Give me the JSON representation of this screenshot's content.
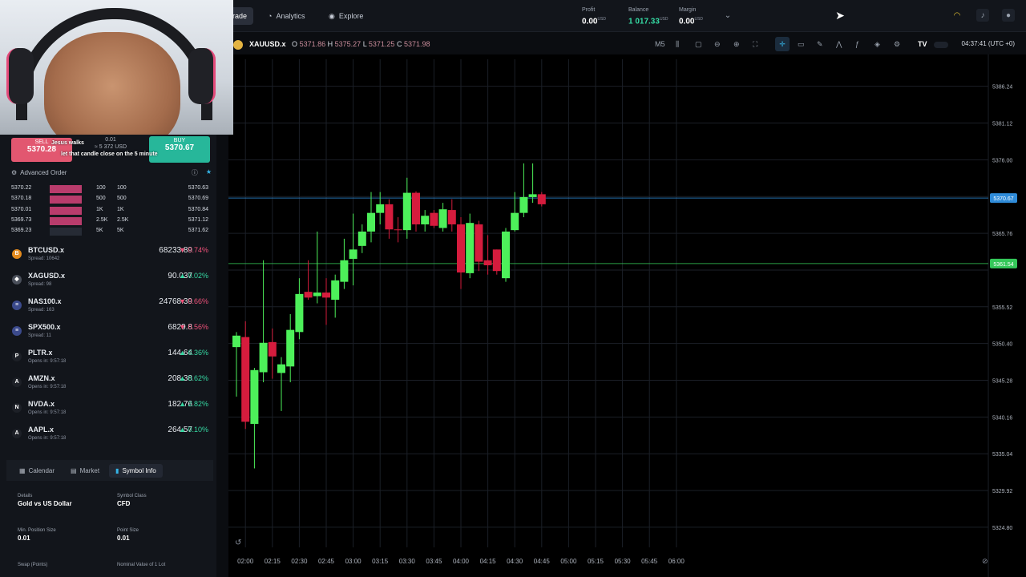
{
  "nav": {
    "trade": "rade",
    "analytics": "Analytics",
    "explore": "Explore"
  },
  "account": {
    "profit_label": "Profit",
    "profit_value": "0.00",
    "balance_label": "Balance",
    "balance_value": "1 017.33",
    "margin_label": "Margin",
    "margin_value": "0.00",
    "currency": "USD"
  },
  "stream": {
    "chat_1": "Jesus walks",
    "chat_2": "let that candle close on the 5 minute"
  },
  "order": {
    "sell_label": "SELL",
    "sell_price": "5370.28",
    "buy_label": "BUY",
    "buy_price": "5370.67",
    "quantity_lot": "0.01",
    "quantity_usd": "≈ 5 372 USD",
    "advanced_label": "Advanced Order"
  },
  "orderbook": [
    {
      "bid": "5370.22",
      "size": "100",
      "size2": "100",
      "ask": "5370.63"
    },
    {
      "bid": "5370.18",
      "size": "500",
      "size2": "500",
      "ask": "5370.69"
    },
    {
      "bid": "5370.01",
      "size": "1K",
      "size2": "1K",
      "ask": "5370.84"
    },
    {
      "bid": "5369.73",
      "size": "2.5K",
      "size2": "2.5K",
      "ask": "5371.12"
    },
    {
      "bid": "5369.23",
      "size": "5K",
      "size2": "5K",
      "ask": "5371.62"
    }
  ],
  "watchlist": [
    {
      "symbol": "BTCUSD.x",
      "sub": "Spread: 10642",
      "price": "68233.89",
      "change": "0.74%",
      "dir": "down",
      "icon": "B",
      "color": "#e38a1d"
    },
    {
      "symbol": "XAGUSD.x",
      "sub": "Spread: 98",
      "price": "90.037",
      "change": "0.02%",
      "dir": "up",
      "icon": "◆",
      "color": "#4a4f5a"
    },
    {
      "symbol": "NAS100.x",
      "sub": "Spread: 163",
      "price": "24768.39",
      "change": "0.66%",
      "dir": "down",
      "icon": "≡",
      "color": "#3b4a8c"
    },
    {
      "symbol": "SPX500.x",
      "sub": "Spread: 11",
      "price": "6829.8",
      "change": "0.56%",
      "dir": "down",
      "icon": "≡",
      "color": "#3b4a8c"
    },
    {
      "symbol": "PLTR.x",
      "sub": "Opens in: 9:57:18",
      "price": "144.64",
      "change": "6.36%",
      "dir": "up",
      "icon": "P",
      "color": "#1d2027"
    },
    {
      "symbol": "AMZN.x",
      "sub": "Opens in: 9:57:18",
      "price": "208.38",
      "change": "0.62%",
      "dir": "up",
      "icon": "A",
      "color": "#1d2027"
    },
    {
      "symbol": "NVDA.x",
      "sub": "Opens in: 9:57:18",
      "price": "182.76",
      "change": "2.82%",
      "dir": "up",
      "icon": "N",
      "color": "#1d2027"
    },
    {
      "symbol": "AAPL.x",
      "sub": "Opens in: 9:57:18",
      "price": "264.57",
      "change": "0.10%",
      "dir": "up",
      "icon": "A",
      "color": "#1d2027"
    }
  ],
  "bottom_tabs": {
    "calendar": "Calendar",
    "market": "Market",
    "symbol_info": "Symbol Info"
  },
  "symbol_info": {
    "details_label": "Details",
    "details_value": "Gold vs US Dollar",
    "class_label": "Symbol Class",
    "class_value": "CFD",
    "min_size_label": "Min. Position Size",
    "min_size_value": "0.01",
    "point_size_label": "Point Size",
    "point_size_value": "0.01",
    "swap_label": "Swap (Points)",
    "nominal_label": "Nominal Value of 1 Lot"
  },
  "chart_header": {
    "symbol": "XAUUSD.x",
    "o_label": "O",
    "o": "5371.86",
    "h_label": "H",
    "h": "5375.27",
    "l_label": "L",
    "l": "5371.25",
    "c_label": "C",
    "c": "5371.98",
    "timeframe": "M5",
    "clock": "04:37:41 (UTC +0)"
  },
  "chart_data": {
    "type": "candlestick",
    "symbol": "XAUUSD.x",
    "timeframe": "M5",
    "ylim": [
      5322,
      5390
    ],
    "y_ticks": [
      5386.24,
      5381.12,
      5376.0,
      5370.88,
      5365.76,
      5360.64,
      5355.52,
      5350.4,
      5345.28,
      5340.16,
      5335.04,
      5329.92,
      5324.8
    ],
    "y_tick_labels": [
      "5386.24",
      "5381.12",
      "5376.00",
      "",
      "5365.76",
      "",
      "5355.52",
      "5350.40",
      "5345.28",
      "5340.16",
      "5335.04",
      "5329.92",
      "5324.80"
    ],
    "x_labels": [
      "02:00",
      "02:15",
      "02:30",
      "02:45",
      "03:00",
      "03:15",
      "03:30",
      "03:45",
      "04:00",
      "04:15",
      "04:30",
      "04:45",
      "05:00",
      "05:15",
      "05:30",
      "05:45",
      "06:00"
    ],
    "x_start": "01:55",
    "x_step_minutes": 5,
    "candles": [
      {
        "o": 5349.9,
        "h": 5352.0,
        "l": 5343.0,
        "c": 5351.5
      },
      {
        "o": 5351.3,
        "h": 5353.5,
        "l": 5338.5,
        "c": 5339.5
      },
      {
        "o": 5339.2,
        "h": 5347.0,
        "l": 5333.0,
        "c": 5346.7
      },
      {
        "o": 5346.4,
        "h": 5362.0,
        "l": 5345.0,
        "c": 5350.5
      },
      {
        "o": 5350.6,
        "h": 5352.5,
        "l": 5345.5,
        "c": 5348.6
      },
      {
        "o": 5346.3,
        "h": 5348.5,
        "l": 5341.0,
        "c": 5347.5
      },
      {
        "o": 5347.2,
        "h": 5354.5,
        "l": 5345.0,
        "c": 5352.3
      },
      {
        "o": 5352.0,
        "h": 5359.5,
        "l": 5351.0,
        "c": 5357.3
      },
      {
        "o": 5357.6,
        "h": 5362.0,
        "l": 5356.5,
        "c": 5356.8
      },
      {
        "o": 5357.0,
        "h": 5366.0,
        "l": 5356.0,
        "c": 5357.5
      },
      {
        "o": 5357.5,
        "h": 5359.5,
        "l": 5353.0,
        "c": 5356.8
      },
      {
        "o": 5356.5,
        "h": 5360.0,
        "l": 5354.0,
        "c": 5359.2
      },
      {
        "o": 5359.0,
        "h": 5365.0,
        "l": 5358.0,
        "c": 5362.0
      },
      {
        "o": 5362.2,
        "h": 5368.5,
        "l": 5358.5,
        "c": 5363.5
      },
      {
        "o": 5364.0,
        "h": 5367.0,
        "l": 5363.0,
        "c": 5366.0
      },
      {
        "o": 5366.0,
        "h": 5371.5,
        "l": 5364.5,
        "c": 5368.6
      },
      {
        "o": 5368.6,
        "h": 5371.5,
        "l": 5367.0,
        "c": 5369.8
      },
      {
        "o": 5369.8,
        "h": 5370.5,
        "l": 5365.0,
        "c": 5366.3
      },
      {
        "o": 5366.3,
        "h": 5368.0,
        "l": 5364.5,
        "c": 5366.2
      },
      {
        "o": 5366.2,
        "h": 5373.5,
        "l": 5365.0,
        "c": 5371.4
      },
      {
        "o": 5371.4,
        "h": 5371.6,
        "l": 5366.0,
        "c": 5367.0
      },
      {
        "o": 5367.0,
        "h": 5369.0,
        "l": 5366.0,
        "c": 5368.2
      },
      {
        "o": 5368.6,
        "h": 5369.0,
        "l": 5366.5,
        "c": 5366.8
      },
      {
        "o": 5366.5,
        "h": 5370.0,
        "l": 5366.0,
        "c": 5369.1
      },
      {
        "o": 5369.0,
        "h": 5370.5,
        "l": 5366.0,
        "c": 5367.0
      },
      {
        "o": 5367.0,
        "h": 5368.0,
        "l": 5358.0,
        "c": 5360.3
      },
      {
        "o": 5360.2,
        "h": 5368.5,
        "l": 5359.5,
        "c": 5367.2
      },
      {
        "o": 5367.0,
        "h": 5367.5,
        "l": 5360.5,
        "c": 5361.8
      },
      {
        "o": 5362.0,
        "h": 5365.5,
        "l": 5360.0,
        "c": 5361.3
      },
      {
        "o": 5363.5,
        "h": 5363.5,
        "l": 5360.0,
        "c": 5360.5
      },
      {
        "o": 5359.5,
        "h": 5366.5,
        "l": 5359.0,
        "c": 5366.0
      },
      {
        "o": 5366.2,
        "h": 5371.5,
        "l": 5366.0,
        "c": 5368.6
      },
      {
        "o": 5368.6,
        "h": 5375.5,
        "l": 5368.0,
        "c": 5370.8
      },
      {
        "o": 5370.8,
        "h": 5375.5,
        "l": 5370.0,
        "c": 5371.2
      },
      {
        "o": 5371.2,
        "h": 5371.5,
        "l": 5369.5,
        "c": 5369.8
      }
    ],
    "price_lines": [
      {
        "price": 5370.67,
        "label": "5370.67",
        "color": "#2f8bd8"
      },
      {
        "price": 5361.54,
        "label": "5361.54",
        "color": "#34c759"
      }
    ],
    "colors": {
      "up": "#4df05a",
      "down": "#d51c3d",
      "background": "#000000"
    }
  }
}
